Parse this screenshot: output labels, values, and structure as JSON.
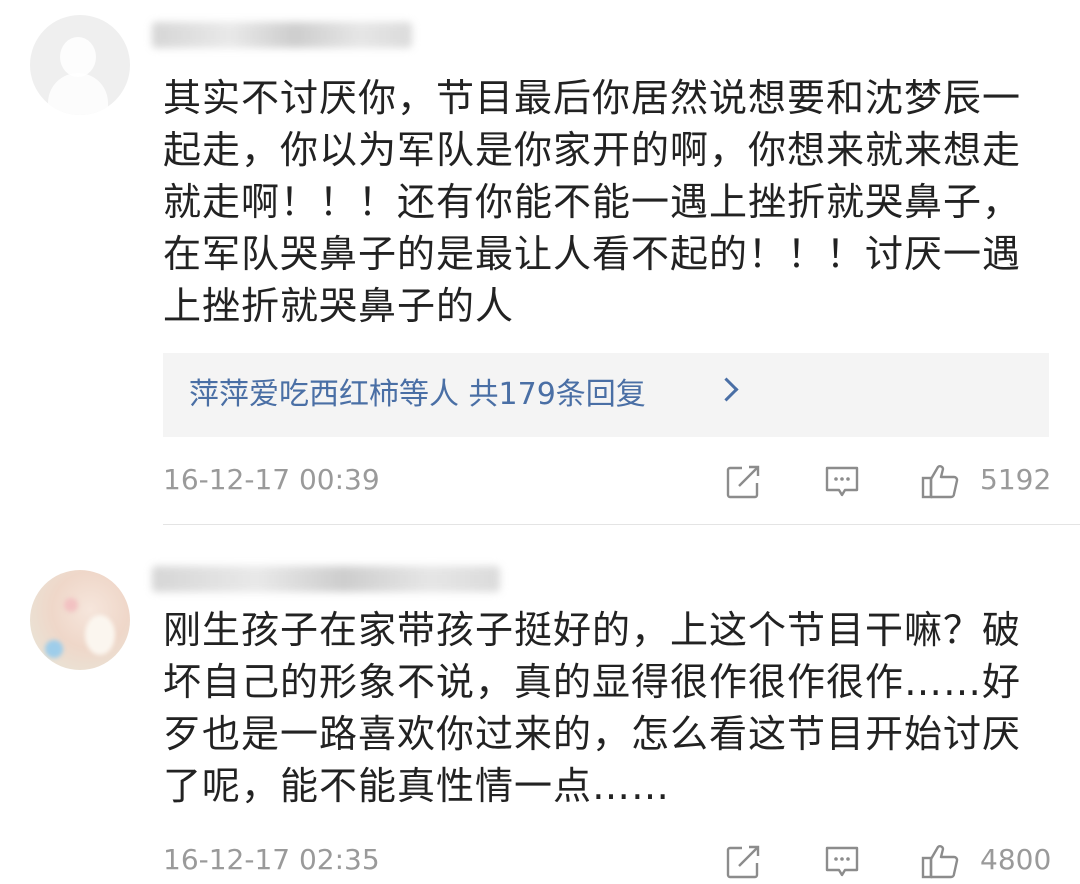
{
  "comments": [
    {
      "text": "其实不讨厌你，节目最后你居然说想要和沈梦辰一起走，你以为军队是你家开的啊，你想来就来想走就走啊！！！还有你能不能一遇上挫折就哭鼻子，在军队哭鼻子的是最让人看不起的！！！讨厌一遇上挫折就哭鼻子的人",
      "replies": "萍萍爱吃西红柿等人  共179条回复",
      "time": "16-12-17 00:39",
      "likes": "5192"
    },
    {
      "text": "刚生孩子在家带孩子挺好的，上这个节目干嘛？破坏自己的形象不说，真的显得很作很作很作……好歹也是一路喜欢你过来的，怎么看这节目开始讨厌了呢，能不能真性情一点……",
      "time": "16-12-17 02:35",
      "likes": "4800"
    }
  ],
  "icons": {
    "share": "share-icon",
    "comment": "comment-icon",
    "like": "like-icon"
  },
  "colors": {
    "link": "#4a6fa5",
    "meta": "#9a9a9a",
    "text": "#222222",
    "reply_bg": "#f4f4f4"
  }
}
